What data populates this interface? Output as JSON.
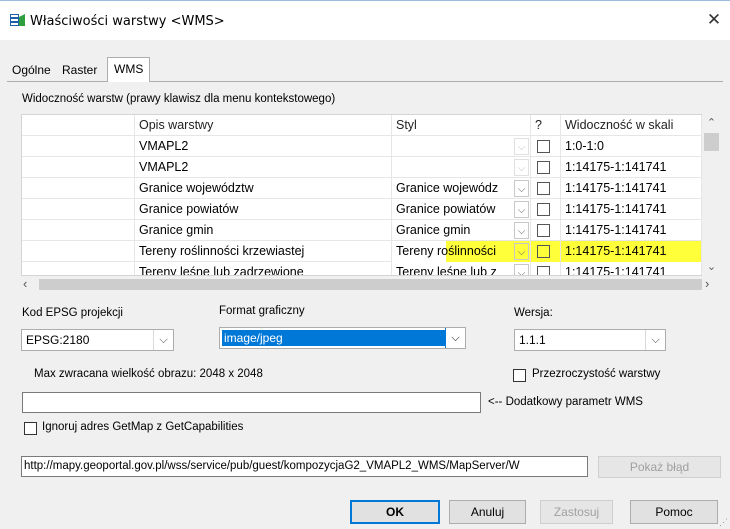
{
  "window": {
    "title": "Właściwości warstwy <WMS>"
  },
  "tabs": [
    "Ogólne",
    "Raster",
    "WMS"
  ],
  "visibility_label": "Widoczność warstw (prawy klawisz dla menu kontekstowego)",
  "grid": {
    "headers": [
      "Opis warstwy",
      "Styl",
      "?",
      "Widoczność w skali"
    ],
    "rows": [
      {
        "name": "VMAPL2",
        "style": "",
        "scale": "1:0-1:0"
      },
      {
        "name": "VMAPL2",
        "style": "",
        "scale": "1:14175-1:141741"
      },
      {
        "name": "Granice województw",
        "style": "Granice wojewódz",
        "scale": "1:14175-1:141741"
      },
      {
        "name": "Granice powiatów",
        "style": "Granice powiatów",
        "scale": "1:14175-1:141741"
      },
      {
        "name": "Granice gmin",
        "style": "Granice gmin",
        "scale": "1:14175-1:141741"
      },
      {
        "name": "Tereny roślinności krzewiastej",
        "style": "Tereny roślinności",
        "scale": "1:14175-1:141741"
      },
      {
        "name": "Tereny leśne lub zadrzewione",
        "style": "Tereny leśne lub z",
        "scale": "1:14175-1:141741"
      }
    ],
    "highlight_color": "#ffff3a"
  },
  "epsg": {
    "label": "Kod EPSG projekcji",
    "value": "EPSG:2180"
  },
  "format": {
    "label": "Format graficzny",
    "value": "image/jpeg",
    "accent": "#0078d7"
  },
  "version": {
    "label": "Wersja:",
    "value": "1.1.1"
  },
  "max_size_label": "Max zwracana wielkość obrazu: 2048 x 2048",
  "transparency_label": "Przezroczystość warstwy",
  "extra_param": {
    "value": "",
    "label": "<-- Dodatkowy parametr WMS"
  },
  "ignore_getmap_label": "Ignoruj adres GetMap z GetCapabilities",
  "url": "http://mapy.geoportal.gov.pl/wss/service/pub/guest/kompozycjaG2_VMAPL2_WMS/MapServer/W",
  "buttons": {
    "show_error": "Pokaż błąd",
    "ok": "OK",
    "cancel": "Anuluj",
    "apply": "Zastosuj",
    "help": "Pomoc"
  },
  "icons": {
    "title": "layers-properties-icon",
    "close": "close-icon",
    "dropdown": "chevron-down-icon",
    "scroll_up": "chevron-up-icon",
    "scroll_down": "chevron-down-icon",
    "scroll_left": "chevron-left-icon",
    "scroll_right": "chevron-right-icon"
  }
}
